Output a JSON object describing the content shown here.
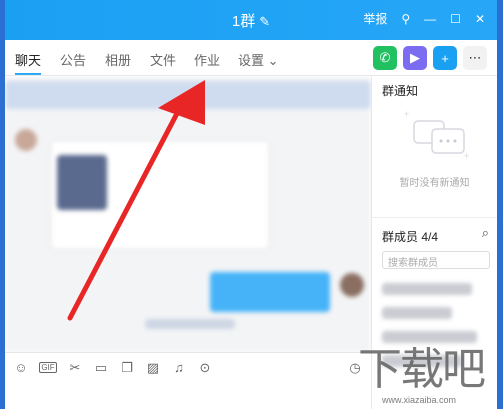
{
  "window": {
    "title": "1群",
    "title_edit_icon": "✎",
    "report_label": "举报",
    "colors": {
      "titlebar": "#1AA0F3",
      "accent": "#1AA0F3",
      "arrow": "#E82626"
    }
  },
  "tabs": {
    "items": [
      {
        "label": "聊天",
        "active": true
      },
      {
        "label": "公告"
      },
      {
        "label": "相册"
      },
      {
        "label": "文件"
      },
      {
        "label": "作业"
      },
      {
        "label": "设置"
      }
    ],
    "settings_chevron": "⌄"
  },
  "sidebar": {
    "notice_title": "群通知",
    "notice_empty": "暂时没有新通知",
    "members_title": "群成员 4/4",
    "member_search_placeholder": "搜索群成员"
  },
  "toolbar": {
    "icons": [
      "emoji-icon",
      "gif-icon",
      "scissors-icon",
      "folder-icon",
      "document-icon",
      "image-icon",
      "bell-icon",
      "more-icon",
      "history-icon"
    ]
  },
  "watermark": {
    "text": "下载吧",
    "url": "www.xiazaiba.com"
  }
}
